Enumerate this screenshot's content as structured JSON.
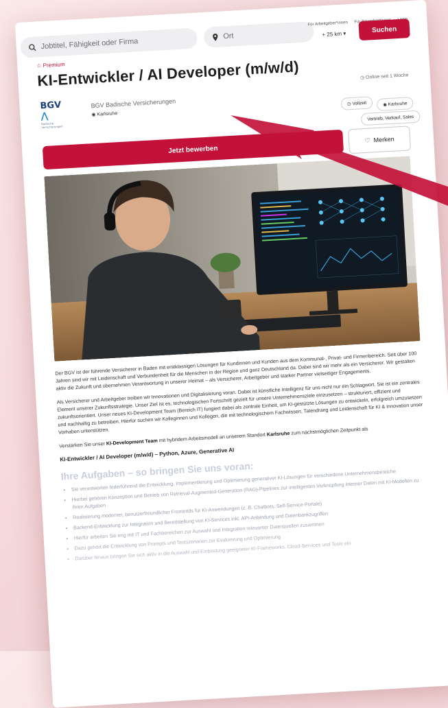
{
  "header": {
    "search_placeholder": "Jobtitel, Fähigkeit oder Firma",
    "location_placeholder": "Ort",
    "radius": "+ 25 km",
    "search_button": "Suchen",
    "links": [
      "Für Arbeitgeber*innen",
      "Für Bewerber*innen",
      "Login"
    ]
  },
  "job": {
    "badge": "Premium",
    "online_since": "Online seit 1 Woche",
    "title": "KI-Entwickler / AI Developer (m/w/d)",
    "company": "BGV Badische Versicherungen",
    "location": "Karlsruhe",
    "logo_text": "BGV",
    "logo_sub": "Badische Versicherungen",
    "tags": [
      "Vollzeit",
      "Karlsruhe",
      "Vertrieb, Verkauf, Sales"
    ],
    "apply_button": "Jetzt bewerben",
    "save_button": "Merken"
  },
  "body": {
    "p1": "Der BGV ist der führende Versicherer in Baden mit erstklassigen Lösungen für Kundinnen und Kunden aus dem Kommunal-, Privat- und Firmenbereich. Seit über 100 Jahren sind wir mit Leidenschaft und Verbundenheit für die Menschen in der Region und ganz Deutschland da. Dabei sind wir mehr als ein Versicherer. Wir gestalten aktiv die Zukunft und übernehmen Verantwortung in unserer Heimat – als Versicherer, Arbeitgeber und starker Partner vielseitiger Engagements.",
    "p2": "Als Versicherer und Arbeitgeber treiben wir Innovationen und Digitalisierung voran. Dabei ist künstliche Intelligenz für uns nicht nur ein Schlagwort. Sie ist ein zentrales Element unserer Zukunftsstrategie. Unser Ziel ist es, technologischen Fortschritt gezielt für unsere Unternehmensziele einzusetzen – strukturiert, effizient und zukunftsorientiert. Unser neues KI-Development Team (Bereich IT) fungiert dabei als zentrale Einheit, um KI-gestützte Lösungen zu entwickeln, erfolgreich umzusetzen und nachhaltig zu betreiben. Hierfür suchen wir Kolleginnen und Kollegen, die mit technologischem Fachwissen, Tatendrang und Leidenschaft für KI & Innovation unser Vorhaben unterstützen.",
    "p3_prefix": "Verstärken Sie unser",
    "p3_team": "KI-Development Team",
    "p3_mid": "mit hybridem Arbeitsmodell an unserem Standort",
    "p3_city": "Karlsruhe",
    "p3_suffix": "zum nächstmöglichen Zeitpunkt als",
    "subline": "KI-Entwickler / AI Developer (m/w/d) – Python, Azure, Generative AI",
    "section_title": "Ihre Aufgaben – so bringen Sie uns voran:",
    "tasks": [
      "Sie verantworten federführend die Entwicklung, Implementierung und Optimierung generativer KI-Lösungen für verschiedene Unternehmensbereiche",
      "Hierbei gehören Konzeption und Betrieb von Retrieval-Augmented-Generation (RAG)-Pipelines zur intelligenten Verknüpfung interner Daten mit KI-Modellen zu Ihren Aufgaben",
      "Realisierung moderner, benutzerfreundlicher Frontends für KI-Anwendungen (z. B. Chatbots, Self-Service-Portale)",
      "Backend-Entwicklung zur Integration und Bereitstellung von KI-Services inkl. API-Anbindung und Datenbankzugriffen",
      "Hierfür arbeiten Sie eng mit IT und Fachbereichen zur Auswahl und Integration relevanter Datenquellen zusammen",
      "Dazu gehört die Entwicklung von Prompts und Testszenarien zur Evaluierung und Optimierung",
      "Darüber hinaus bringen Sie sich aktiv in die Auswahl und Einbindung geeigneter KI-Frameworks, Cloud-Services und Tools ein"
    ]
  },
  "colors": {
    "brand": "#c2123a",
    "arrow": "#c2123a"
  }
}
